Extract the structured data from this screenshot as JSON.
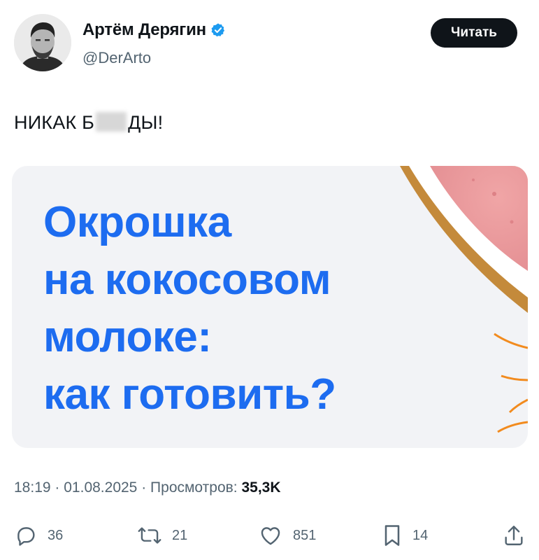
{
  "author": {
    "display_name": "Артём Дерягин",
    "handle": "@DerArto",
    "verified_icon": "verified-badge-icon",
    "avatar_icon": "avatar"
  },
  "follow_button": {
    "label": "Читать"
  },
  "tweet": {
    "text_before": "НИКАК Б",
    "text_after": "ДЫ!"
  },
  "media": {
    "lines": [
      "Окрошка",
      "на кокосовом",
      "молоке:",
      "как готовить?"
    ],
    "accent_color": "#1d6cf0"
  },
  "meta": {
    "time": "18:19",
    "date": "01.08.2025",
    "views_label": "Просмотров:",
    "views_value": "35,3K"
  },
  "actions": {
    "reply": {
      "icon": "reply-icon",
      "count": "36"
    },
    "retweet": {
      "icon": "retweet-icon",
      "count": "21"
    },
    "like": {
      "icon": "like-icon",
      "count": "851"
    },
    "bookmark": {
      "icon": "bookmark-icon",
      "count": "14"
    },
    "share": {
      "icon": "share-icon"
    }
  }
}
